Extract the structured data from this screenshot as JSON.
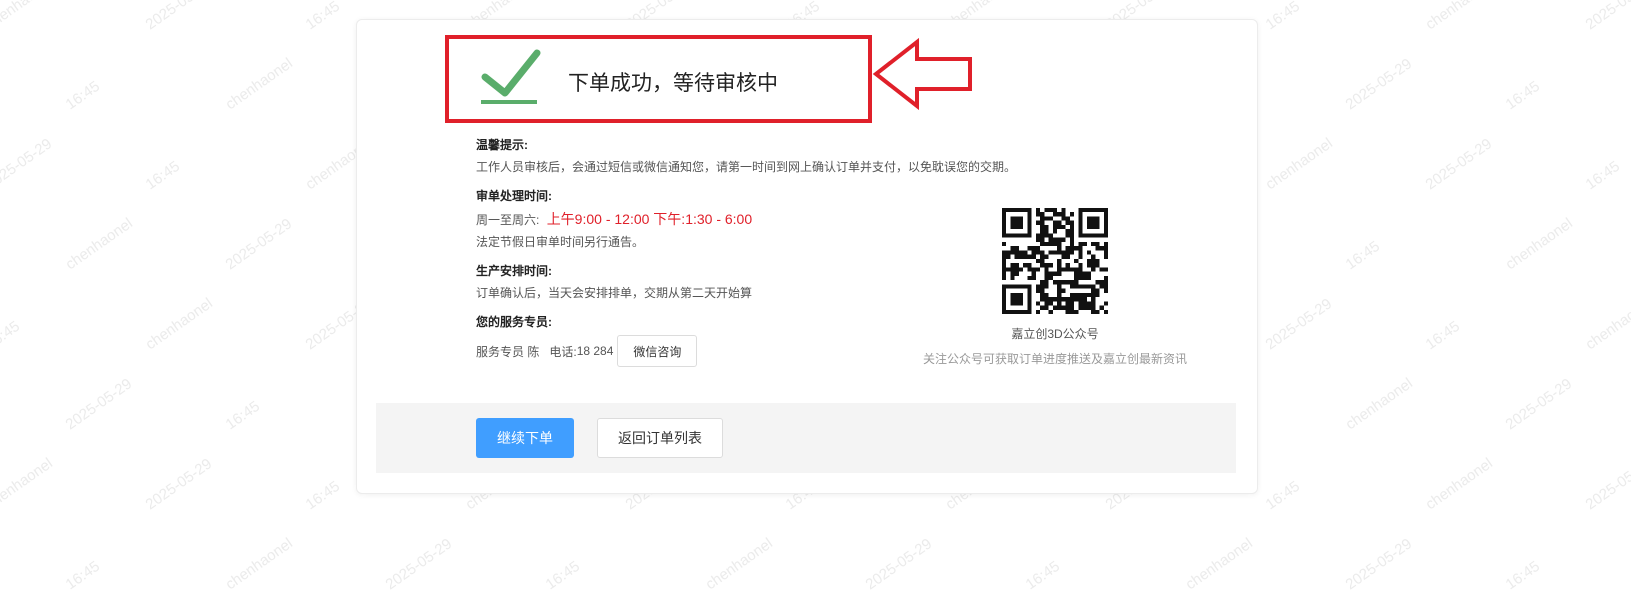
{
  "watermark": {
    "texts": [
      "chenhaonel",
      "2025-05-29",
      "16:45"
    ]
  },
  "success": {
    "title": "下单成功，等待审核中",
    "icon": "checkmark-icon",
    "highlight_color": "#e0202a",
    "check_color": "#5aad6b"
  },
  "tips": {
    "warm_head": "温馨提示:",
    "warm_text": "工作人员审核后，会通过短信或微信通知您，请第一时间到网上确认订单并支付，以免耽误您的交期。",
    "review_head": "审单处理时间:",
    "review_days": "周一至周六:",
    "review_hours": "上午9:00 - 12:00 下午:1:30 - 6:00",
    "review_holiday": "法定节假日审单时间另行通告。",
    "production_head": "生产安排时间:",
    "production_text": "订单确认后，当天会安排排单，交期从第二天开始算",
    "service_head": "您的服务专员:",
    "service_name": "服务专员 陈",
    "service_phone_label": "电话:",
    "service_phone": "18     284",
    "wechat_button": "微信咨询"
  },
  "qr": {
    "title": "嘉立创3D公众号",
    "subtitle": "关注公众号可获取订单进度推送及嘉立创最新资讯"
  },
  "footer": {
    "continue_button": "继续下单",
    "back_button": "返回订单列表",
    "primary_color": "#409eff"
  }
}
